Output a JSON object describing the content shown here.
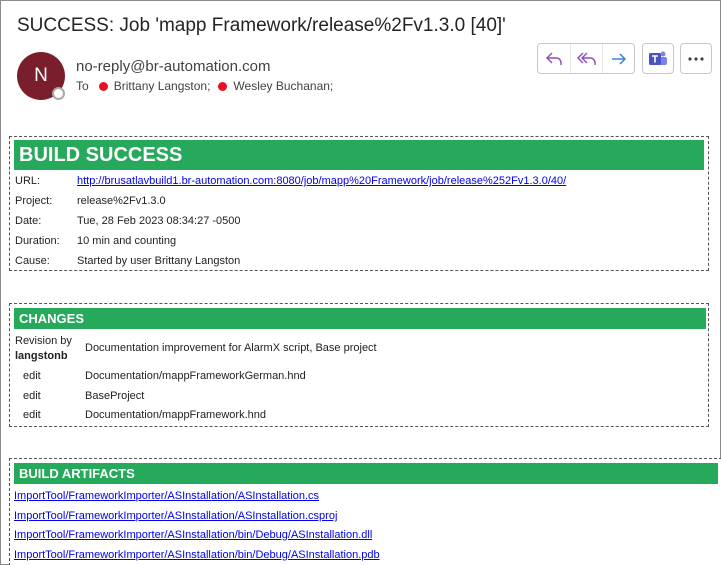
{
  "email": {
    "subject": "SUCCESS: Job 'mapp Framework/release%2Fv1.3.0 [40]'",
    "sender_initial": "N",
    "sender": "no-reply@br-automation.com",
    "to_label": "To",
    "recipients": [
      "Brittany Langston;",
      "Wesley Buchanan;"
    ],
    "presence_color": "#e81123"
  },
  "actions": {
    "reply_icon": "reply-icon",
    "reply_all_icon": "reply-all-icon",
    "forward_icon": "forward-icon",
    "teams_icon": "teams-icon",
    "more_icon": "more-icon"
  },
  "build": {
    "header": "BUILD SUCCESS",
    "header_color": "#27a95b",
    "rows": [
      {
        "key": "URL:",
        "value": "http://brusatlavbuild1.br-automation.com:8080/job/mapp%20Framework/job/release%252Fv1.3.0/40/"
      },
      {
        "key": "Project:",
        "value": "release%2Fv1.3.0"
      },
      {
        "key": "Date:",
        "value": "Tue, 28 Feb 2023 08:34:27 -0500"
      },
      {
        "key": "Duration:",
        "value": "10 min and counting"
      },
      {
        "key": "Cause:",
        "value": "Started by user Brittany Langston"
      }
    ]
  },
  "changes": {
    "header": "CHANGES",
    "revision_label": "Revision by",
    "revision_author": "langstonb",
    "message": "Documentation improvement for AlarmX script, Base project",
    "items": [
      {
        "action": "edit",
        "path": "Documentation/mappFrameworkGerman.hnd"
      },
      {
        "action": "edit",
        "path": "BaseProject"
      },
      {
        "action": "edit",
        "path": "Documentation/mappFramework.hnd"
      }
    ]
  },
  "artifacts": {
    "header": "BUILD ARTIFACTS",
    "items": [
      "ImportTool/FrameworkImporter/ASInstallation/ASInstallation.cs",
      "ImportTool/FrameworkImporter/ASInstallation/ASInstallation.csproj",
      "ImportTool/FrameworkImporter/ASInstallation/bin/Debug/ASInstallation.dll",
      "ImportTool/FrameworkImporter/ASInstallation/bin/Debug/ASInstallation.pdb"
    ]
  }
}
